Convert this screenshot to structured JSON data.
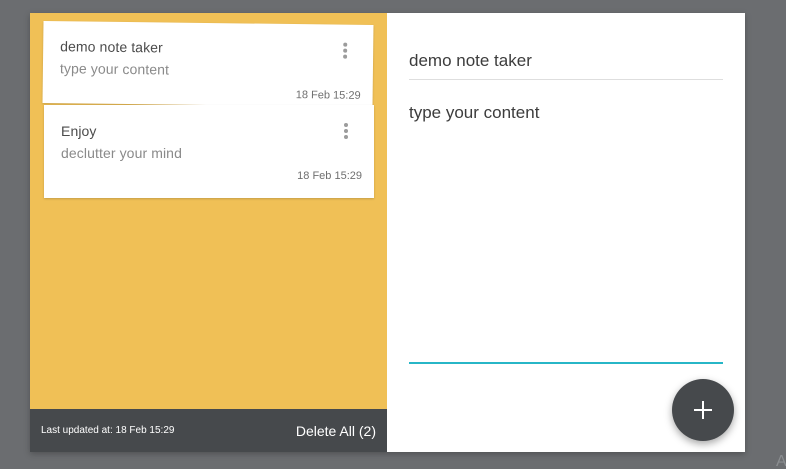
{
  "notes": [
    {
      "title": "demo note taker",
      "content": "type your content",
      "date": "18 Feb 15:29"
    },
    {
      "title": "Enjoy",
      "content": "declutter your mind",
      "date": "18 Feb 15:29"
    }
  ],
  "footer": {
    "last_updated": "Last updated at: 18 Feb 15:29",
    "delete_all": "Delete All (2)"
  },
  "editor": {
    "title_value": "demo note taker",
    "content_value": "type your content"
  },
  "fab": {
    "icon": "plus-icon"
  },
  "background_edge": {
    "letter": "A"
  },
  "colors": {
    "page_background": "#6b6d70",
    "sidebar": "#f0c056",
    "footer": "#46494c",
    "accent": "#27b6c7",
    "fab": "#46494c"
  }
}
